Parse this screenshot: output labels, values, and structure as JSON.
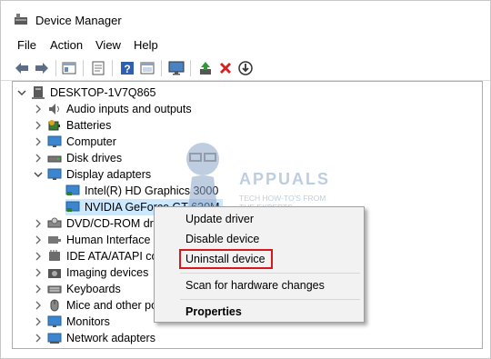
{
  "window": {
    "title": "Device Manager"
  },
  "menu": [
    "File",
    "Action",
    "View",
    "Help"
  ],
  "toolbar": {
    "icons": [
      "back-icon",
      "forward-icon",
      "properties-icon",
      "help-page-icon",
      "help-icon",
      "console-icon",
      "monitor-icon",
      "update-driver-icon",
      "uninstall-icon",
      "download-icon"
    ]
  },
  "tree": {
    "root": "DESKTOP-1V7Q865",
    "items": [
      {
        "label": "Audio inputs and outputs",
        "icon": "speaker-icon"
      },
      {
        "label": "Batteries",
        "icon": "battery-icon"
      },
      {
        "label": "Computer",
        "icon": "computer-icon"
      },
      {
        "label": "Disk drives",
        "icon": "disk-icon"
      },
      {
        "label": "Display adapters",
        "icon": "display-adapter-icon",
        "expanded": true,
        "children": [
          "Intel(R) HD Graphics 3000",
          "NVIDIA GeForce GT 630M"
        ]
      },
      {
        "label": "DVD/CD-ROM drives",
        "icon": "dvd-icon"
      },
      {
        "label": "Human Interface Devices",
        "icon": "hid-icon"
      },
      {
        "label": "IDE ATA/ATAPI controllers",
        "icon": "ide-icon"
      },
      {
        "label": "Imaging devices",
        "icon": "camera-icon"
      },
      {
        "label": "Keyboards",
        "icon": "keyboard-icon"
      },
      {
        "label": "Mice and other pointing devices",
        "icon": "mouse-icon"
      },
      {
        "label": "Monitors",
        "icon": "monitor-icon"
      },
      {
        "label": "Network adapters",
        "icon": "network-icon"
      }
    ]
  },
  "context_menu": {
    "items": [
      "Update driver",
      "Disable device",
      "Uninstall device",
      "Scan for hardware changes",
      "Properties"
    ],
    "highlighted": "Uninstall device"
  },
  "watermark": {
    "title": "APPUALS",
    "line1": "TECH HOW-TO'S FROM",
    "line2": "THE EXPERTS"
  },
  "colors": {
    "selection": "#cce8ff",
    "highlight_border": "#d6191e",
    "accent_blue": "#1e78c8"
  }
}
